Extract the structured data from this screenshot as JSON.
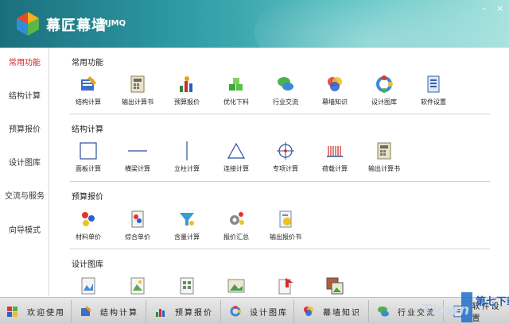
{
  "app": {
    "title": "幕匠幕墙",
    "subtitle": "MJMQ"
  },
  "window": {
    "minimize": "–",
    "close": "×"
  },
  "sidebar": {
    "items": [
      {
        "label": "常用功能",
        "active": true
      },
      {
        "label": "结构计算"
      },
      {
        "label": "预算报价"
      },
      {
        "label": "设计图库"
      },
      {
        "label": "交流与服务"
      },
      {
        "label": "向导模式"
      }
    ]
  },
  "sections": [
    {
      "title": "常用功能",
      "tiles": [
        {
          "label": "结构计算",
          "icon": "pencil-ruler-icon"
        },
        {
          "label": "输出计算书",
          "icon": "calculator-doc-icon"
        },
        {
          "label": "预算报价",
          "icon": "budget-chart-icon"
        },
        {
          "label": "优化下料",
          "icon": "green-cubes-icon"
        },
        {
          "label": "行业交流",
          "icon": "chat-bubbles-icon"
        },
        {
          "label": "幕墙知识",
          "icon": "color-circles-icon"
        },
        {
          "label": "设计图库",
          "icon": "colorful-ring-icon"
        },
        {
          "label": "软件设置",
          "icon": "settings-doc-icon"
        }
      ]
    },
    {
      "title": "结构计算",
      "tiles": [
        {
          "label": "面板计算",
          "icon": "square-outline-icon"
        },
        {
          "label": "横梁计算",
          "icon": "horizontal-line-icon"
        },
        {
          "label": "立柱计算",
          "icon": "vertical-line-icon"
        },
        {
          "label": "连接计算",
          "icon": "triangle-outline-icon"
        },
        {
          "label": "专项计算",
          "icon": "crosshair-icon"
        },
        {
          "label": "荷载计算",
          "icon": "load-bars-icon"
        },
        {
          "label": "输出计算书",
          "icon": "calculator-doc-icon"
        }
      ]
    },
    {
      "title": "预算报价",
      "tiles": [
        {
          "label": "材料单价",
          "icon": "dots-cluster-icon"
        },
        {
          "label": "综合单价",
          "icon": "price-doc-icon"
        },
        {
          "label": "含量计算",
          "icon": "funnel-icon"
        },
        {
          "label": "报价汇总",
          "icon": "gear-dots-icon"
        },
        {
          "label": "输出报价书",
          "icon": "quote-doc-icon"
        }
      ]
    },
    {
      "title": "设计图库",
      "tiles": [
        {
          "label": "",
          "icon": "drawing-doc-icon"
        },
        {
          "label": "",
          "icon": "image-doc-icon"
        },
        {
          "label": "",
          "icon": "grid-doc-icon"
        },
        {
          "label": "",
          "icon": "picture-icon"
        },
        {
          "label": "",
          "icon": "export-doc-icon"
        },
        {
          "label": "",
          "icon": "stacked-pictures-icon"
        }
      ]
    }
  ],
  "taskbar": {
    "items": [
      {
        "label": "欢迎使用",
        "icon": "welcome-flag-icon"
      },
      {
        "label": "结构计算",
        "icon": "pencil-ruler-icon"
      },
      {
        "label": "预算报价",
        "icon": "budget-chart-icon"
      },
      {
        "label": "设计图库",
        "icon": "colorful-ring-icon"
      },
      {
        "label": "幕墙知识",
        "icon": "color-circles-icon"
      },
      {
        "label": "行业交流",
        "icon": "chat-bubbles-icon"
      },
      {
        "label": "软件设置",
        "icon": "settings-doc-icon"
      }
    ]
  },
  "watermark": {
    "text": "第七下载"
  },
  "colors": {
    "accent_red": "#d12020",
    "title_teal": "#2d9aa4"
  }
}
